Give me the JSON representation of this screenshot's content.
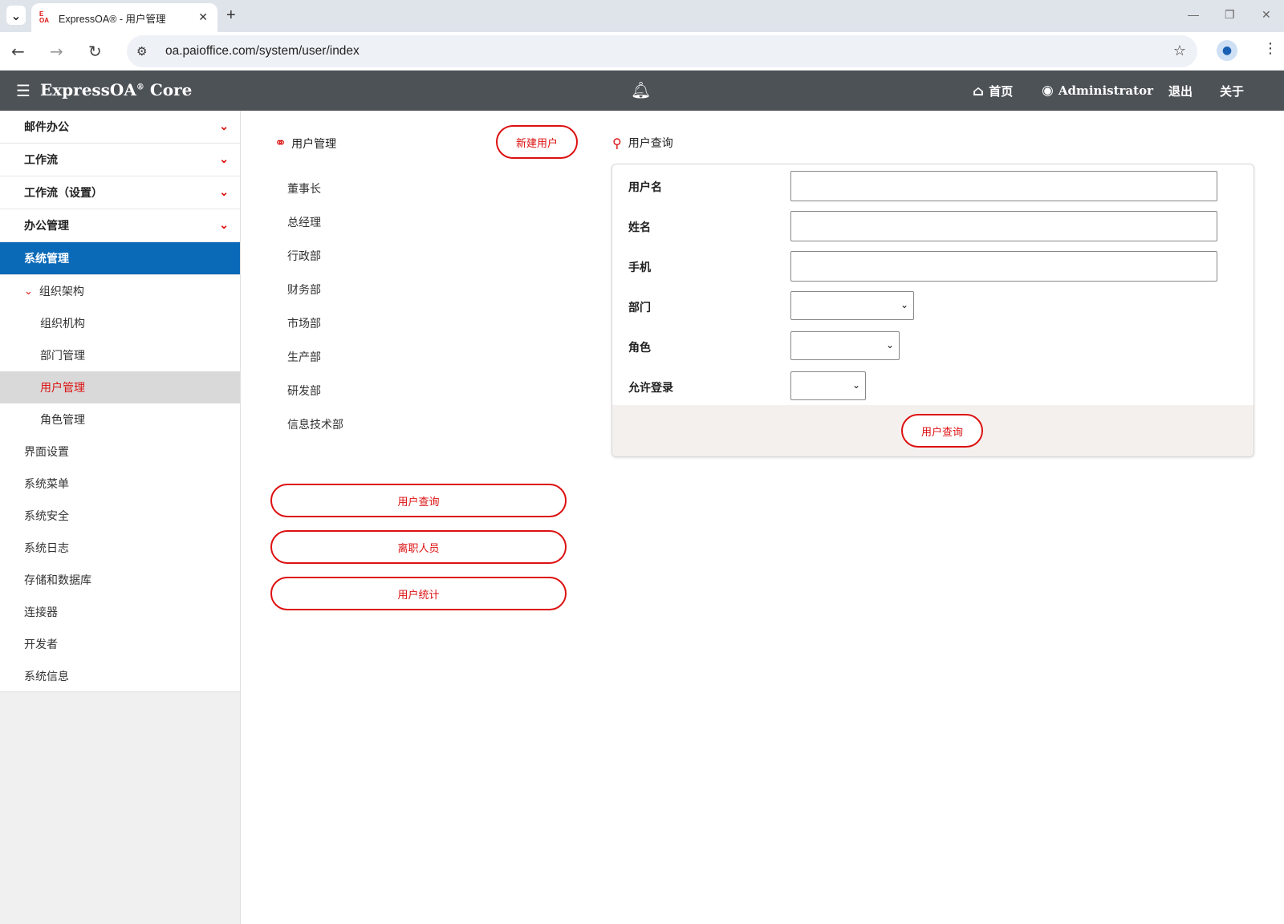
{
  "browser": {
    "tab_title": "ExpressOA® - 用户管理",
    "favicon_text": "E OA",
    "url": "oa.paioffice.com/system/user/index"
  },
  "app": {
    "brand": "ExpressOA",
    "brand_mark": "®",
    "brand_suffix": "Core",
    "nav": {
      "home": "首页",
      "user": "Administrator",
      "logout": "退出",
      "about": "关于"
    }
  },
  "sidebar": {
    "groups": [
      {
        "label": "邮件办公"
      },
      {
        "label": "工作流"
      },
      {
        "label": "工作流（设置）"
      },
      {
        "label": "办公管理"
      },
      {
        "label": "系统管理"
      }
    ],
    "org_section": "组织架构",
    "org_items": [
      {
        "label": "组织机构"
      },
      {
        "label": "部门管理"
      },
      {
        "label": "用户管理"
      },
      {
        "label": "角色管理"
      }
    ],
    "system_items": [
      {
        "label": "界面设置"
      },
      {
        "label": "系统菜单"
      },
      {
        "label": "系统安全"
      },
      {
        "label": "系统日志"
      },
      {
        "label": "存储和数据库"
      },
      {
        "label": "连接器"
      },
      {
        "label": "开发者"
      },
      {
        "label": "系统信息"
      }
    ]
  },
  "middle": {
    "title": "用户管理",
    "new_user_button": "新建用户",
    "departments": [
      "董事长",
      "总经理",
      "行政部",
      "财务部",
      "市场部",
      "生产部",
      "研发部",
      "信息技术部"
    ],
    "buttons": {
      "query": "用户查询",
      "resigned": "离职人员",
      "stats": "用户统计"
    }
  },
  "query": {
    "title": "用户查询",
    "fields": {
      "username": {
        "label": "用户名",
        "value": ""
      },
      "name": {
        "label": "姓名",
        "value": ""
      },
      "phone": {
        "label": "手机",
        "value": ""
      },
      "department": {
        "label": "部门",
        "value": ""
      },
      "role": {
        "label": "角色",
        "value": ""
      },
      "allow_login": {
        "label": "允许登录",
        "value": ""
      }
    },
    "submit": "用户查询"
  },
  "colors": {
    "accent_red": "#dd1111",
    "header_bg": "#4d5257",
    "active_blue": "#0a6ab8"
  }
}
